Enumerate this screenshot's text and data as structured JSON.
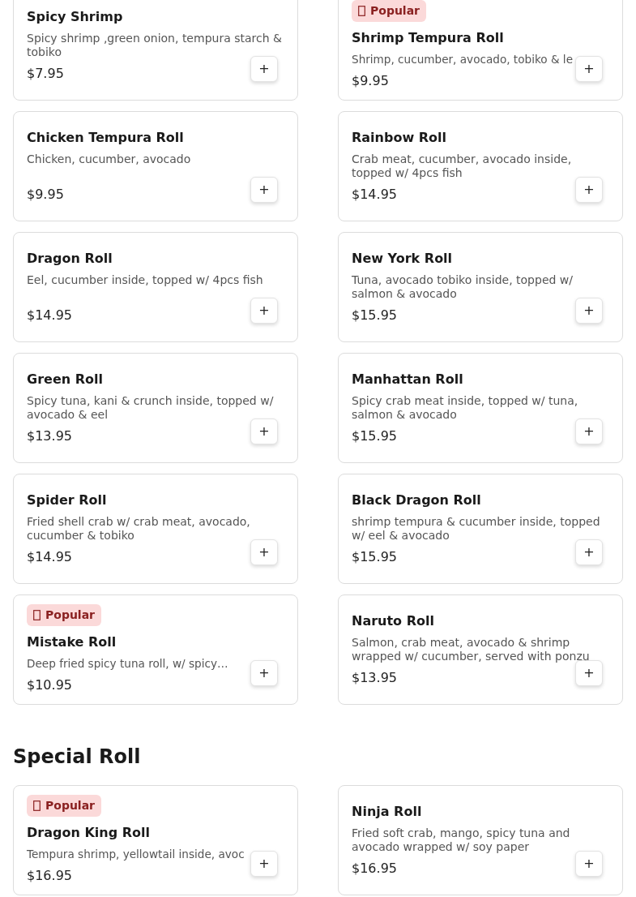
{
  "sections": [
    {
      "items": [
        {
          "name": "Spicy Shrimp",
          "description": "Spicy shrimp ,green onion, tempura starch & tobiko",
          "price": "$7.95",
          "add": "+"
        },
        {
          "badge": "Popular",
          "name": "Shrimp Tempura Roll",
          "description": "Shrimp, cucumber, avocado, tobiko & le",
          "clipped": true,
          "price": "$9.95",
          "add": "+"
        },
        {
          "name": "Chicken Tempura Roll",
          "description": "Chicken, cucumber, avocado",
          "price": "$9.95",
          "add": "+"
        },
        {
          "name": "Rainbow Roll",
          "description": "Crab meat, cucumber, avocado inside, topped w/ 4pcs fish",
          "price": "$14.95",
          "add": "+"
        },
        {
          "name": "Dragon Roll",
          "description": "Eel, cucumber inside, topped w/ 4pcs fish",
          "price": "$14.95",
          "add": "+"
        },
        {
          "name": "New York Roll",
          "description": "Tuna, avocado tobiko inside, topped w/ salmon & avocado",
          "price": "$15.95",
          "add": "+"
        },
        {
          "name": "Green Roll",
          "description": "Spicy tuna, kani & crunch inside, topped w/ avocado & eel",
          "price": "$13.95",
          "add": "+"
        },
        {
          "name": "Manhattan Roll",
          "description": "Spicy crab meat inside, topped w/ tuna, salmon & avocado",
          "price": "$15.95",
          "add": "+"
        },
        {
          "name": "Spider Roll",
          "description": "Fried shell crab w/ crab meat, avocado, cucumber & tobiko",
          "price": "$14.95",
          "add": "+"
        },
        {
          "name": "Black Dragon Roll",
          "description": "shrimp tempura & cucumber inside, topped w/ eel & avocado",
          "price": "$15.95",
          "add": "+"
        },
        {
          "badge": "Popular",
          "name": "Mistake Roll",
          "description": "Deep fried spicy tuna roll, w/ spicy…",
          "clipped": true,
          "price": "$10.95",
          "add": "+"
        },
        {
          "name": "Naruto Roll",
          "description": "Salmon, crab meat, avocado & shrimp wrapped w/ cucumber, served with ponzu",
          "price": "$13.95",
          "add": "+"
        }
      ]
    },
    {
      "title": "Special Roll",
      "items": [
        {
          "badge": "Popular",
          "name": "Dragon King Roll",
          "description": "Tempura shrimp, yellowtail inside, avoc",
          "clipped": true,
          "price": "$16.95",
          "add": "+"
        },
        {
          "name": "Ninja Roll",
          "description": "Fried soft crab, mango, spicy tuna and avocado wrapped w/ soy paper",
          "price": "$16.95",
          "add": "+"
        }
      ]
    }
  ]
}
